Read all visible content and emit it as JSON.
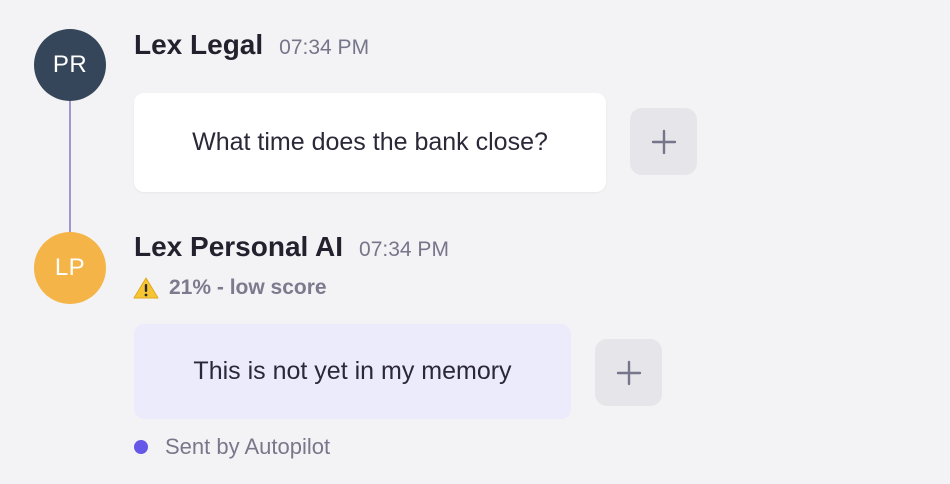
{
  "messages": [
    {
      "avatar_initials": "PR",
      "avatar_color": "#35465a",
      "sender": "Lex Legal",
      "time": "07:34 PM",
      "text": "What time does the bank close?",
      "bubble_color": "#ffffff",
      "action_icon": "plus-icon"
    },
    {
      "avatar_initials": "LP",
      "avatar_color": "#f5b447",
      "sender": "Lex Personal AI",
      "time": "07:34 PM",
      "score_icon": "warning-icon",
      "score_text": "21% - low score",
      "text": "This is not yet in my memory",
      "bubble_color": "#ecebfb",
      "action_icon": "plus-icon",
      "status_dot_color": "#6558e8",
      "status_text": "Sent by Autopilot"
    }
  ],
  "thread_line_color": "#9e98cf"
}
